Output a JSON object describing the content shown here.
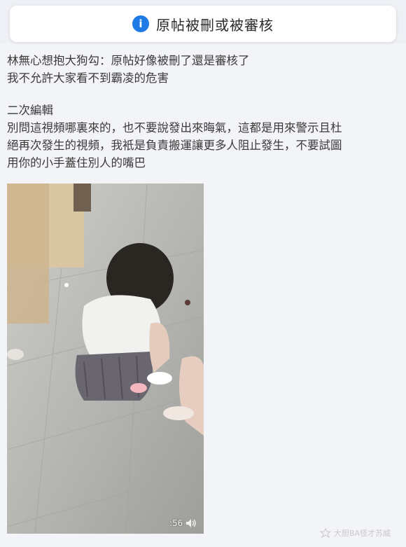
{
  "notice": {
    "icon": "info-icon",
    "icon_glyph": "i",
    "text": "原帖被刪或被審核",
    "accent_color": "#1e7be6"
  },
  "post": {
    "lines": [
      "林無心想抱大狗勾：原帖好像被刪了還是審核了",
      "我不允許大家看不到霸凌的危害"
    ],
    "edit_heading": "二次編輯",
    "edit_lines": [
      "別問這視頻哪裏來的，也不要說發出來晦氣，這都是用來警示且杜",
      "絕再次發生的視頻，我衹是負責搬運讓更多人阻止發生，不要試圖",
      "用你的小手蓋住別人的嘴巴"
    ]
  },
  "video": {
    "time_label": ":56",
    "volume_icon": "volume-icon"
  },
  "watermark": {
    "text": "大胆BA怪才苏威"
  }
}
